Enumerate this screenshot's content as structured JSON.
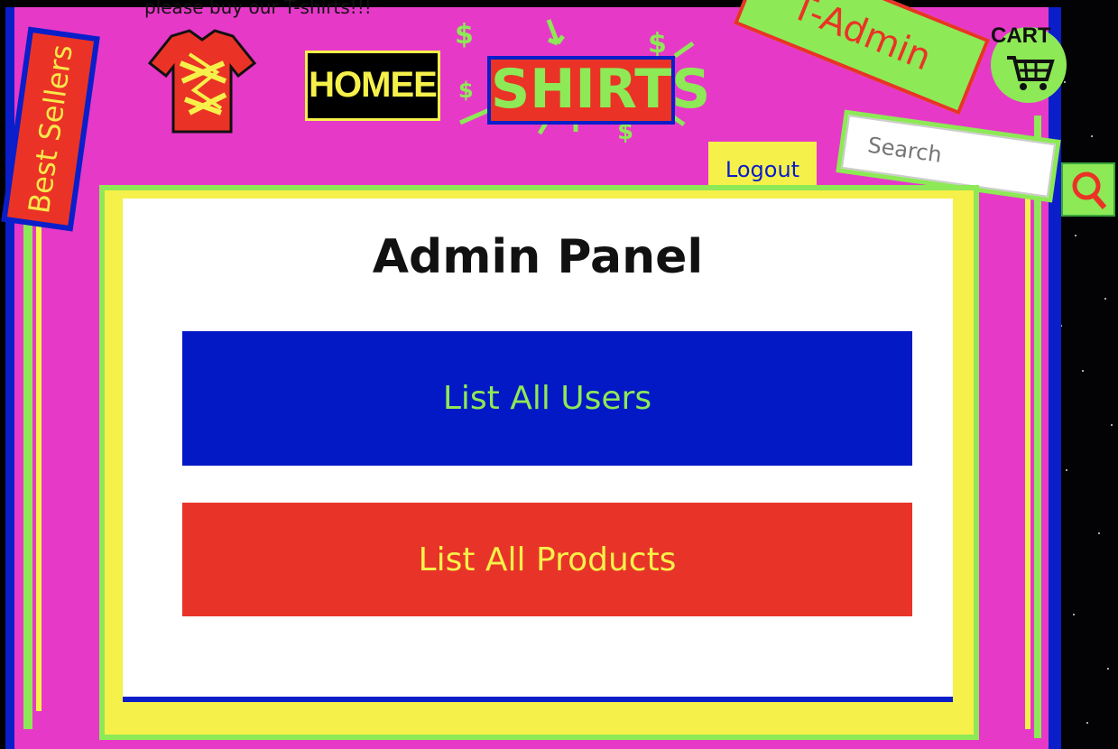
{
  "header": {
    "tagline": "please buy our T-shirts!!!",
    "best_sellers_label": "Best Sellers",
    "home_label": "HOMEE",
    "shirts_label": "SHIRTS",
    "admin_badge_label": "T-Admin",
    "cart_label": "CART",
    "logout_label": "Logout"
  },
  "search": {
    "placeholder": "Search"
  },
  "panel": {
    "title": "Admin Panel",
    "list_users_label": "List All Users",
    "list_products_label": "List All Products"
  },
  "colors": {
    "page_pink": "#e639c8",
    "blue": "#0a1ec9",
    "red": "#ea3326",
    "green": "#8de956",
    "yellow": "#f6f14a"
  },
  "icons": [
    "tshirt-icon",
    "cart-icon",
    "search-icon",
    "arrow-icon",
    "dollar-icon"
  ]
}
